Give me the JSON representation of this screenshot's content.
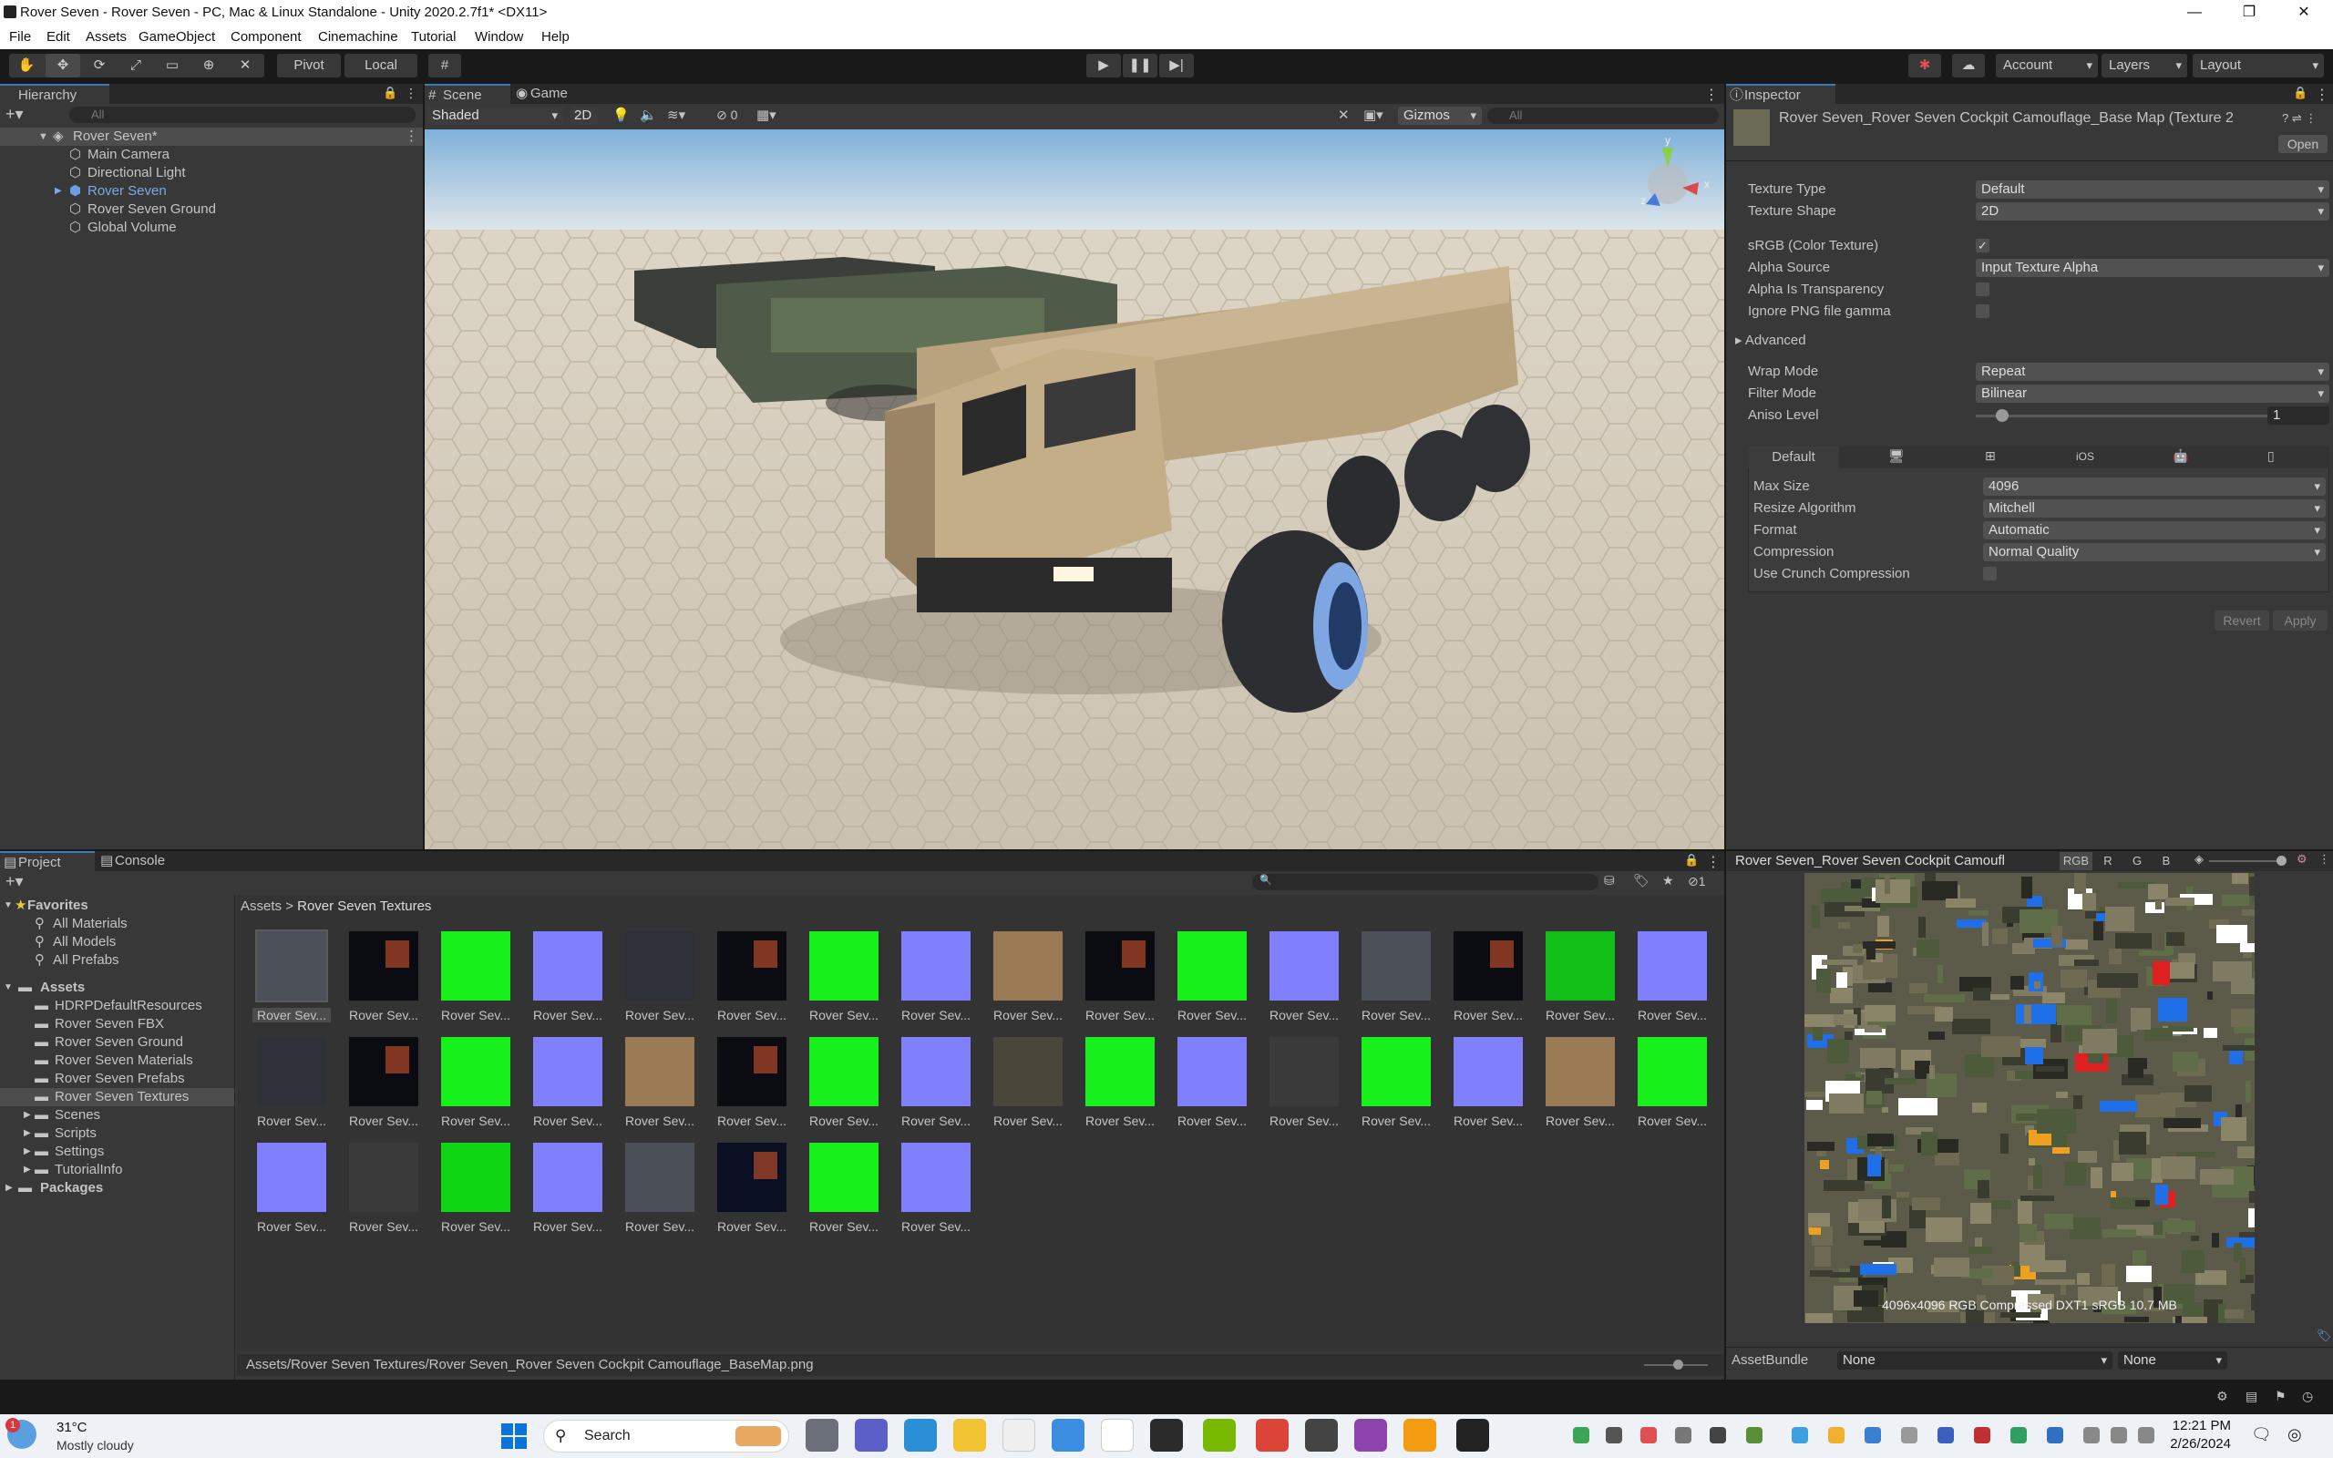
{
  "window": {
    "title": "Rover Seven - Rover Seven - PC, Mac & Linux Standalone - Unity 2020.2.7f1* <DX11>"
  },
  "menu": [
    "File",
    "Edit",
    "Assets",
    "GameObject",
    "Component",
    "Cinemachine",
    "Tutorial",
    "Window",
    "Help"
  ],
  "toolbar": {
    "pivot": "Pivot",
    "local": "Local",
    "account": "Account",
    "layers": "Layers",
    "layout": "Layout"
  },
  "hierarchy": {
    "tab": "Hierarchy",
    "search_placeholder": "All",
    "scene": "Rover Seven*",
    "items": [
      "Main Camera",
      "Directional Light",
      "Rover Seven",
      "Rover Seven Ground",
      "Global Volume"
    ]
  },
  "scene_view": {
    "tabs": [
      "Scene",
      "Game"
    ],
    "shading": "Shaded",
    "mode_2d": "2D",
    "hidden_count": "0",
    "gizmos": "Gizmos",
    "search_placeholder": "All",
    "gizmo_axes": {
      "y": "y",
      "x": "x",
      "z": "z"
    }
  },
  "inspector": {
    "tab": "Inspector",
    "asset_title": "Rover Seven_Rover Seven Cockpit Camouflage_Base Map (Texture 2",
    "open": "Open",
    "rows": [
      {
        "label": "Texture Type",
        "value": "Default"
      },
      {
        "label": "Texture Shape",
        "value": "2D"
      }
    ],
    "srgb": "sRGB (Color Texture)",
    "alpha_source_label": "Alpha Source",
    "alpha_source": "Input Texture Alpha",
    "alpha_transparency": "Alpha Is Transparency",
    "ignore_png": "Ignore PNG file gamma",
    "advanced": "Advanced",
    "wrap_label": "Wrap Mode",
    "wrap": "Repeat",
    "filter_label": "Filter Mode",
    "filter": "Bilinear",
    "aniso_label": "Aniso Level",
    "aniso": "1",
    "platform_tab": "Default",
    "platform_tab_ios": "iOS",
    "max_size_label": "Max Size",
    "max_size": "4096",
    "resize_label": "Resize Algorithm",
    "resize": "Mitchell",
    "format_label": "Format",
    "format": "Automatic",
    "compression_label": "Compression",
    "compression": "Normal Quality",
    "crunch": "Use Crunch Compression",
    "revert": "Revert",
    "apply": "Apply"
  },
  "preview": {
    "title": "Rover Seven_Rover Seven Cockpit Camoufl",
    "channels": [
      "RGB",
      "R",
      "G",
      "B"
    ],
    "info": "4096x4096  RGB Compressed DXT1 sRGB  10.7 MB",
    "assetbundle_label": "AssetBundle",
    "assetbundle": "None",
    "variant": "None"
  },
  "project": {
    "tabs": [
      "Project",
      "Console"
    ],
    "hidden_count": "1",
    "favorites": "Favorites",
    "fav_items": [
      "All Materials",
      "All Models",
      "All Prefabs"
    ],
    "assets": "Assets",
    "folders": [
      "HDRPDefaultResources",
      "Rover Seven FBX",
      "Rover Seven Ground",
      "Rover Seven Materials",
      "Rover Seven Prefabs",
      "Rover Seven Textures",
      "Scenes",
      "Scripts",
      "Settings",
      "TutorialInfo"
    ],
    "packages": "Packages",
    "breadcrumb": [
      "Assets",
      "Rover Seven Textures"
    ],
    "item_label": "Rover Sev...",
    "status_path": "Assets/Rover Seven Textures/Rover Seven_Rover Seven Cockpit Camouflage_BaseMap.png"
  },
  "textures": [
    "camo",
    "black",
    "green",
    "blue",
    "camo-dark",
    "black",
    "green",
    "blue",
    "sand",
    "black",
    "green",
    "blue",
    "camo",
    "black",
    "green-dark",
    "blue",
    "camo-dark",
    "black",
    "green",
    "blue",
    "sand",
    "black",
    "green",
    "blue",
    "camo-gray",
    "green",
    "blue",
    "gray",
    "green",
    "blue",
    "sand",
    "green",
    "blue",
    "gray",
    "green-mask",
    "blue",
    "gray-dark",
    "black-blue",
    "green",
    "blue"
  ],
  "taskbar": {
    "temp": "31°C",
    "weather": "Mostly cloudy",
    "weather_badge": "1",
    "search": "Search",
    "time": "12:21 PM",
    "date": "2/26/2024"
  }
}
